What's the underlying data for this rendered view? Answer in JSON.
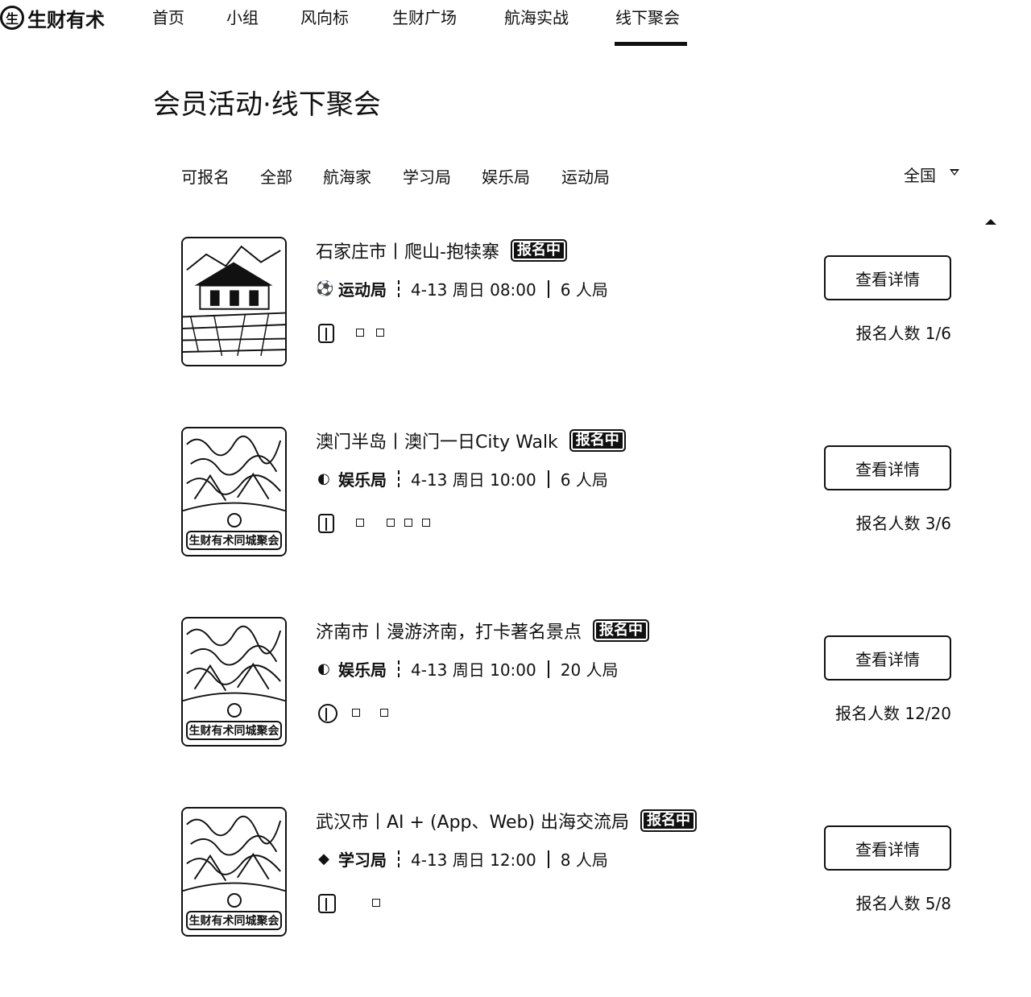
{
  "logo": {
    "mark": "生",
    "text": "生财有术"
  },
  "nav": {
    "items": [
      {
        "label": "首页",
        "name": "nav-home"
      },
      {
        "label": "小组",
        "name": "nav-groups"
      },
      {
        "label": "风向标",
        "name": "nav-trends"
      },
      {
        "label": "生财广场",
        "name": "nav-plaza"
      },
      {
        "label": "航海实战",
        "name": "nav-voyage"
      },
      {
        "label": "线下聚会",
        "name": "nav-offline",
        "active": true
      }
    ]
  },
  "page_title": "会员活动·线下聚会",
  "filters": [
    "可报名",
    "全部",
    "航海家",
    "学习局",
    "娱乐局",
    "运动局"
  ],
  "region": {
    "label": "全国",
    "icon": "caret-down-icon"
  },
  "events": [
    {
      "title": "石家庄市丨爬山-抱犊寨",
      "badge": "报名中",
      "category": "运动局",
      "category_icon": "soccer-ball-icon",
      "date": "4-13 周日 08:00",
      "size": "6 人局",
      "button": "查看详情",
      "signup": "报名人数 1/6",
      "thumb_banner": ""
    },
    {
      "title": "澳门半岛丨澳门一日City Walk",
      "badge": "报名中",
      "category": "娱乐局",
      "category_icon": "party-icon",
      "date": "4-13 周日 10:00",
      "size": "6 人局",
      "button": "查看详情",
      "signup": "报名人数 3/6",
      "thumb_banner": "生财有术同城聚会"
    },
    {
      "title": "济南市丨漫游济南，打卡著名景点",
      "badge": "报名中",
      "category": "娱乐局",
      "category_icon": "party-icon",
      "date": "4-13 周日 10:00",
      "size": "20 人局",
      "button": "查看详情",
      "signup": "报名人数 12/20",
      "thumb_banner": "生财有术同城聚会"
    },
    {
      "title": "武汉市丨AI + (App、Web) 出海交流局",
      "badge": "报名中",
      "category": "学习局",
      "category_icon": "graduation-cap-icon",
      "date": "4-13 周日 12:00",
      "size": "8 人局",
      "button": "查看详情",
      "signup": "报名人数 5/8",
      "thumb_banner": "生财有术同城聚会"
    }
  ]
}
